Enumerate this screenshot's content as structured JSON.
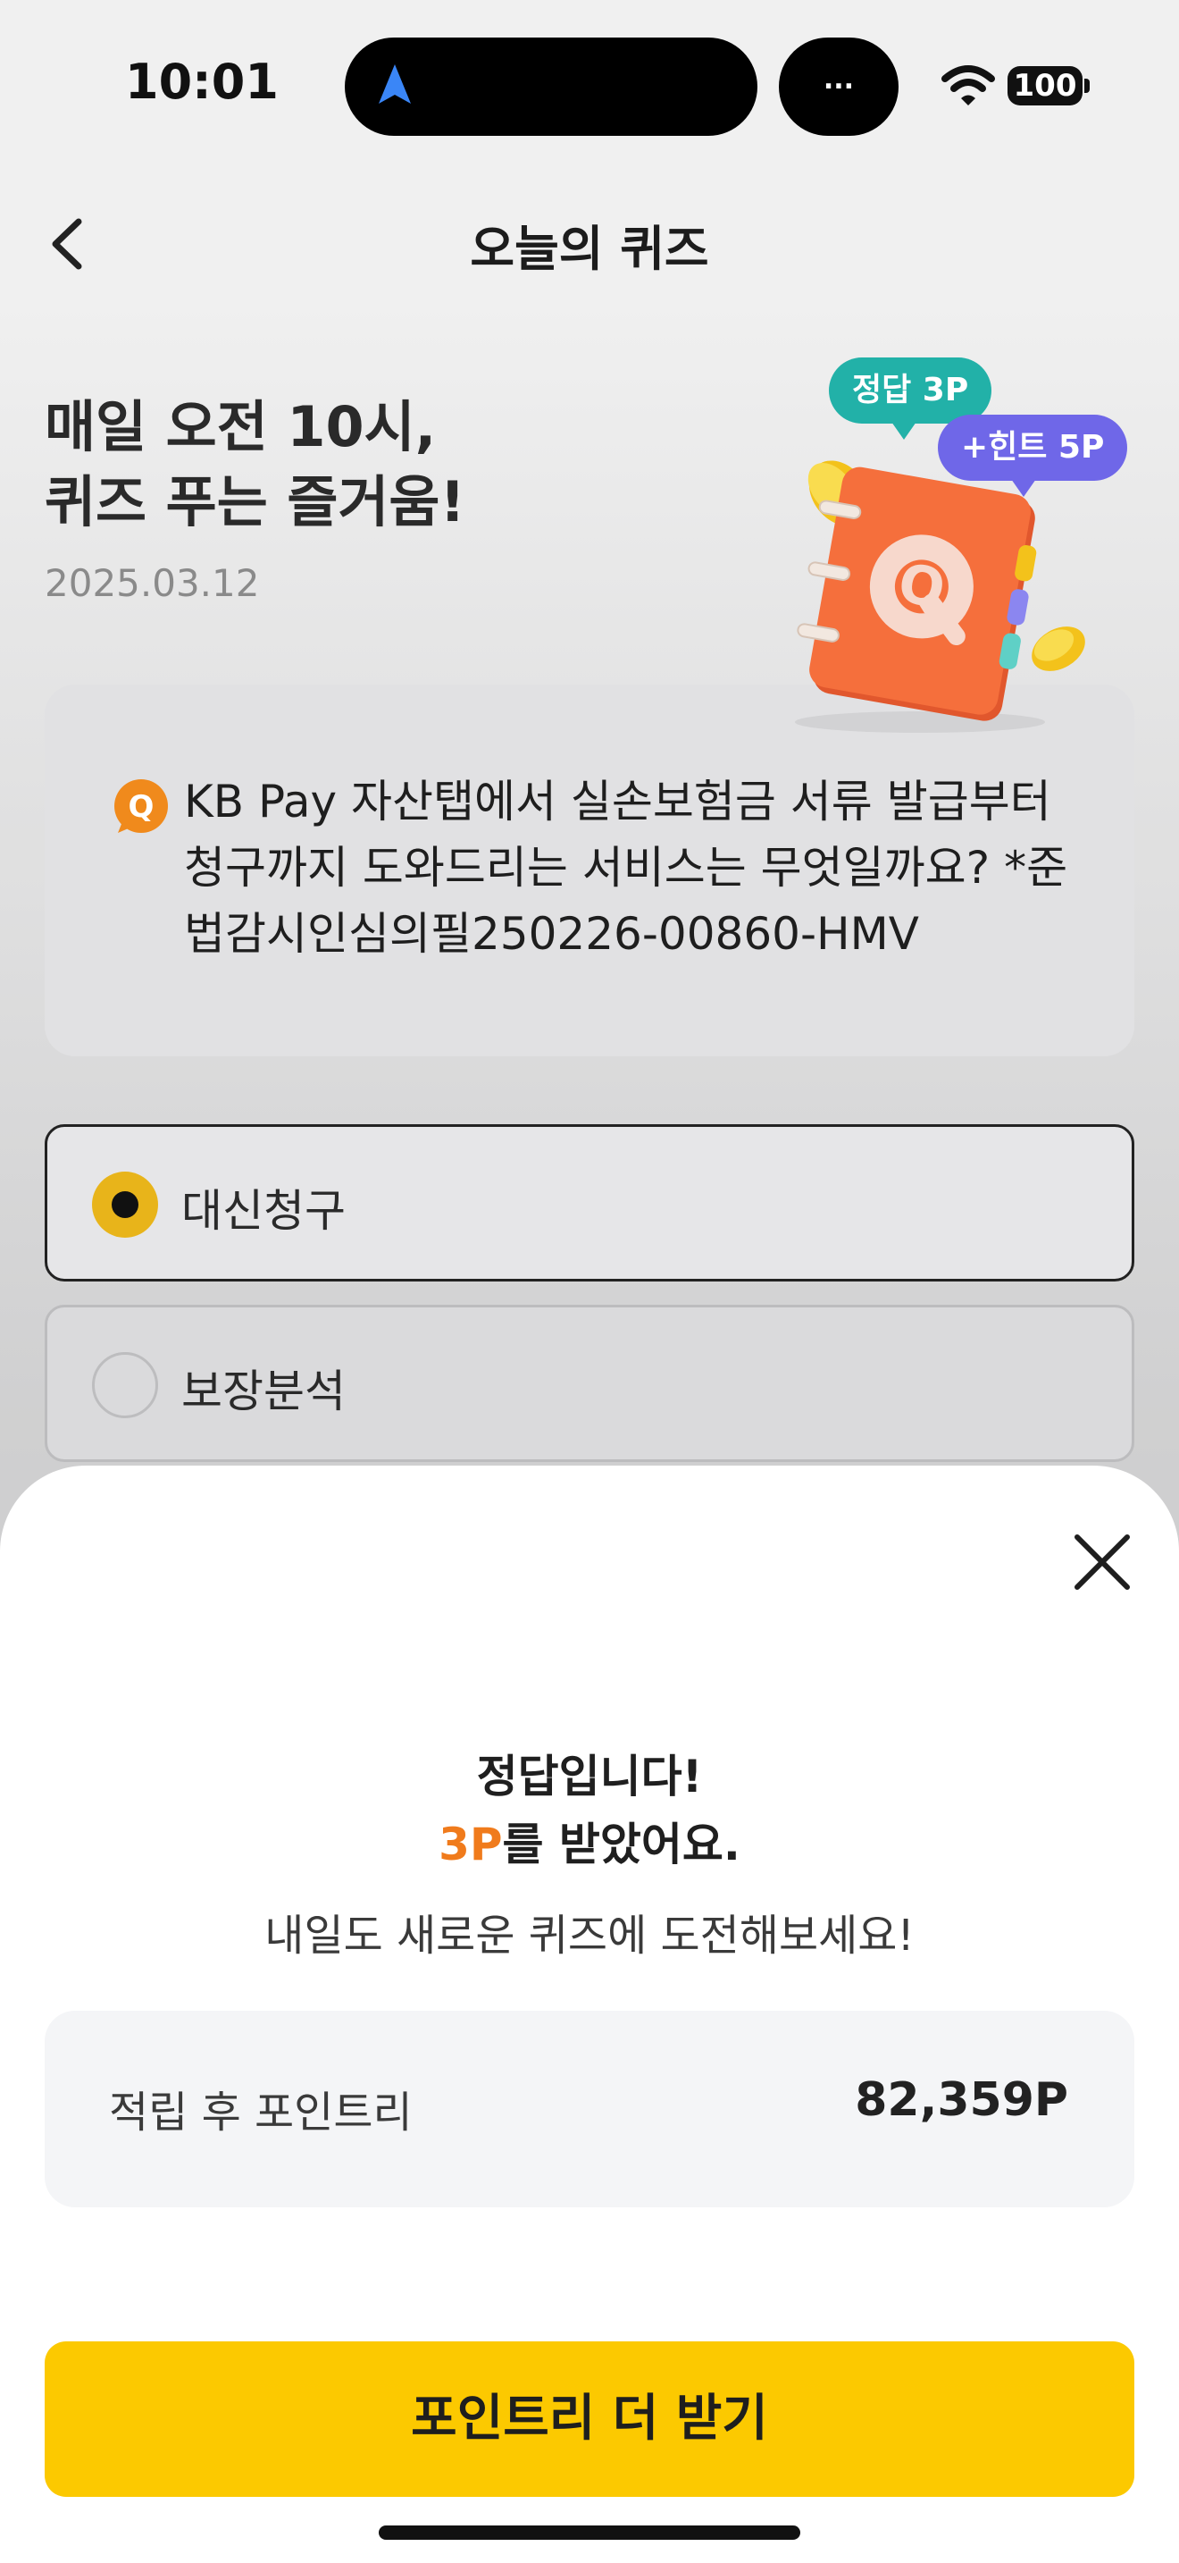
{
  "status_bar": {
    "time": "10:01",
    "island_menu": "...",
    "battery": "100"
  },
  "header": {
    "title": "오늘의 퀴즈"
  },
  "hero": {
    "title_line1": "매일 오전 10시,",
    "title_line2": "퀴즈 푸는 즐거움!",
    "date": "2025.03.12",
    "badge_correct": "정답 3P",
    "badge_hint": "+힌트 5P",
    "illustration_letter": "Q"
  },
  "question": {
    "badge": "Q",
    "text": "KB Pay 자산탭에서 실손보험금 서류 발급부터 청구까지 도와드리는 서비스는 무엇일까요? *준법감시인심의필250226-00860-HMV"
  },
  "options": [
    {
      "label": "대신청구",
      "selected": true
    },
    {
      "label": "보장분석",
      "selected": false
    }
  ],
  "result": {
    "title": "정답입니다!",
    "points_awarded": "3P",
    "points_suffix": "를 받았어요.",
    "subtitle": "내일도 새로운 퀴즈에 도전해보세요!",
    "balance_label": "적립 후 포인트리",
    "balance_value": "82,359P",
    "cta_label": "포인트리 더 받기"
  },
  "colors": {
    "accent_yellow": "#fcc900",
    "accent_orange": "#f07b1c",
    "badge_green": "#22b1a8",
    "badge_purple": "#6f67e8",
    "radio_selected": "#e8b41a"
  },
  "icons": [
    "navigation-arrow-icon",
    "wifi-icon",
    "battery-icon",
    "back-chevron-icon",
    "quiz-book-illustration",
    "close-icon"
  ]
}
